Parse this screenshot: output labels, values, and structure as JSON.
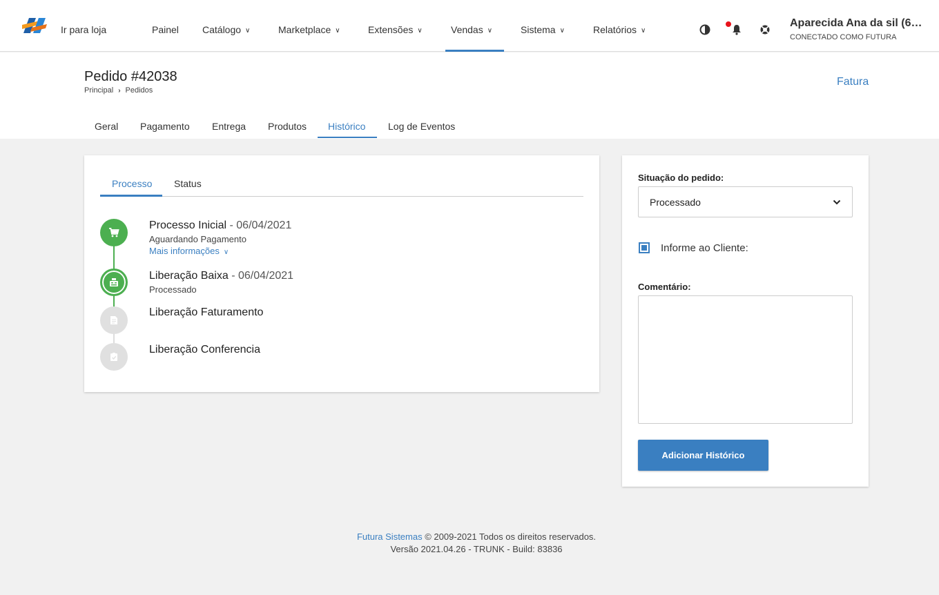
{
  "nav": {
    "logo_icon": "futura-logo",
    "items": [
      {
        "label": "Ir para loja",
        "dropdown": false
      },
      {
        "label": "Painel",
        "dropdown": false
      },
      {
        "label": "Catálogo",
        "dropdown": true
      },
      {
        "label": "Marketplace",
        "dropdown": true
      },
      {
        "label": "Extensões",
        "dropdown": true
      },
      {
        "label": "Vendas",
        "dropdown": true,
        "active": true
      },
      {
        "label": "Sistema",
        "dropdown": true
      },
      {
        "label": "Relatórios",
        "dropdown": true
      }
    ],
    "icons": [
      "contrast-icon",
      "bell-icon",
      "help-lifebuoy-icon"
    ],
    "user": {
      "name": "Aparecida Ana da sil (6…",
      "sub": "CONECTADO COMO FUTURA"
    }
  },
  "header": {
    "title": "Pedido #42038",
    "breadcrumb": [
      "Principal",
      "Pedidos"
    ],
    "breadcrumb_sep": "›",
    "action": "Fatura",
    "tabs": [
      "Geral",
      "Pagamento",
      "Entrega",
      "Produtos",
      "Histórico",
      "Log de Eventos"
    ],
    "active_tab": "Histórico"
  },
  "history": {
    "subtabs": [
      "Processo",
      "Status"
    ],
    "active_subtab": "Processo",
    "steps": [
      {
        "title": "Processo Inicial",
        "date": " - 06/04/2021",
        "status": "Aguardando Pagamento",
        "more": "Mais informações",
        "icon": "cart-icon",
        "state": "done"
      },
      {
        "title": "Liberação Baixa",
        "date": " - 06/04/2021",
        "status": "Processado",
        "icon": "cash-register-icon",
        "state": "current"
      },
      {
        "title": "Liberação Faturamento",
        "icon": "document-icon",
        "state": "pending"
      },
      {
        "title": "Liberação Conferencia",
        "icon": "clipboard-check-icon",
        "state": "pending"
      }
    ]
  },
  "form": {
    "status_label": "Situação do pedido:",
    "status_value": "Processado",
    "notify_label": "Informe ao Cliente:",
    "notify_checked": true,
    "comment_label": "Comentário:",
    "comment_value": "",
    "submit": "Adicionar Histórico"
  },
  "footer": {
    "brand": "Futura Sistemas",
    "copyright": " © 2009-2021 Todos os direitos reservados.",
    "version": "Versão 2021.04.26 - TRUNK - Build: 83836"
  },
  "colors": {
    "accent": "#3a7fc1",
    "success": "#4caf50",
    "pending": "#e0e0e0",
    "notify": "#e8131b"
  }
}
